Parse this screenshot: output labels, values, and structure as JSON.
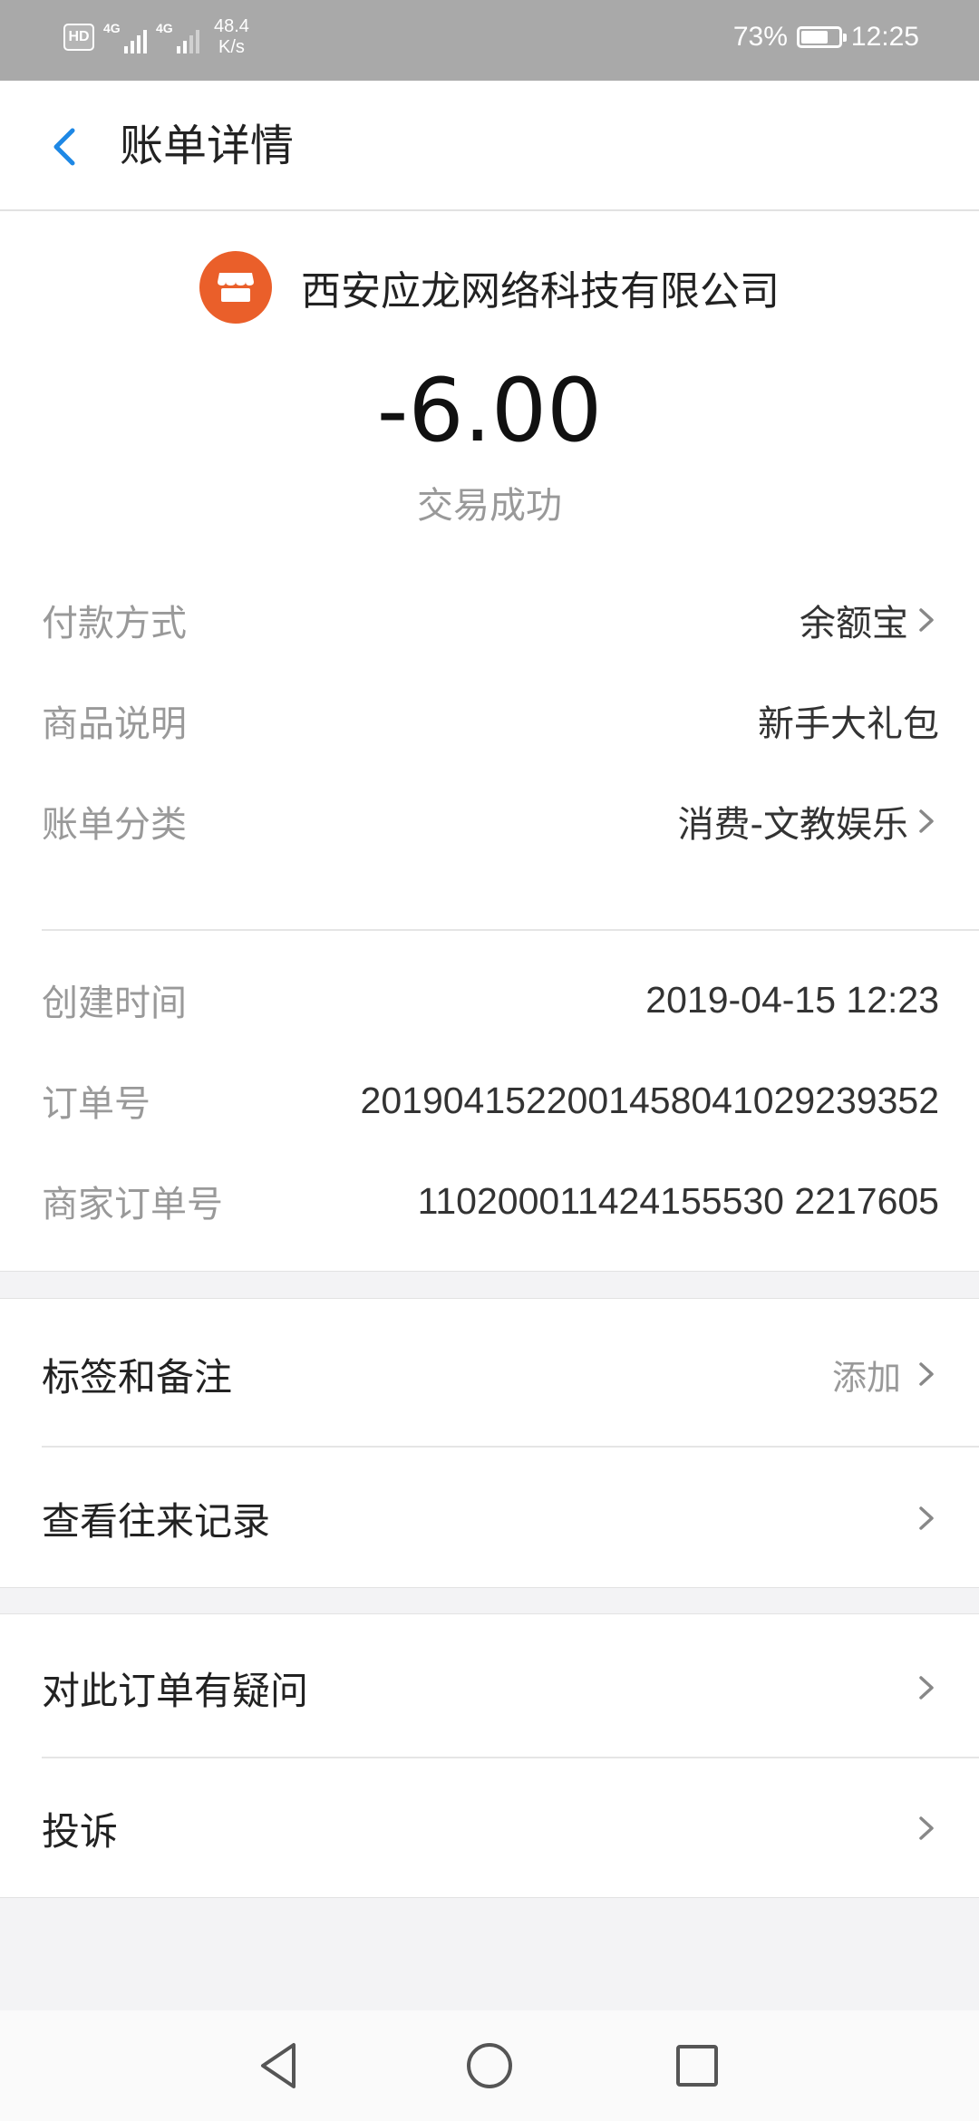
{
  "status_bar": {
    "hd": "HD",
    "net1": "4G",
    "net2": "4G",
    "speed_value": "48.4",
    "speed_unit": "K/s",
    "battery_percent": "73%",
    "battery_level": 0.73,
    "time": "12:25"
  },
  "header": {
    "title": "账单详情",
    "back_icon": "chevron-left-icon"
  },
  "summary": {
    "merchant_icon": "store-icon",
    "merchant_name": "西安应龙网络科技有限公司",
    "amount": "-6.00",
    "status": "交易成功"
  },
  "details": [
    {
      "label": "付款方式",
      "value": "余额宝",
      "has_arrow": true
    },
    {
      "label": "商品说明",
      "value": "新手大礼包",
      "has_arrow": false
    },
    {
      "label": "账单分类",
      "value": "消费-文教娱乐",
      "has_arrow": true
    }
  ],
  "order_info": [
    {
      "label": "创建时间",
      "value": "2019-04-15 12:23"
    },
    {
      "label": "订单号",
      "value": "2019041522001458041029239352"
    },
    {
      "label": "商家订单号",
      "value": "110200011424155530 2217605"
    }
  ],
  "actions_group1": [
    {
      "label": "标签和备注",
      "hint": "添加"
    },
    {
      "label": "查看往来记录",
      "hint": ""
    }
  ],
  "actions_group2": [
    {
      "label": "对此订单有疑问",
      "hint": ""
    },
    {
      "label": "投诉",
      "hint": ""
    }
  ],
  "nav": {
    "back": "triangle-back-icon",
    "home": "circle-home-icon",
    "recent": "square-recent-icon"
  },
  "colors": {
    "accent": "#1e88e5",
    "merchant_icon_bg": "#ea5f2a",
    "status_bar_bg": "#a9a9a9"
  }
}
